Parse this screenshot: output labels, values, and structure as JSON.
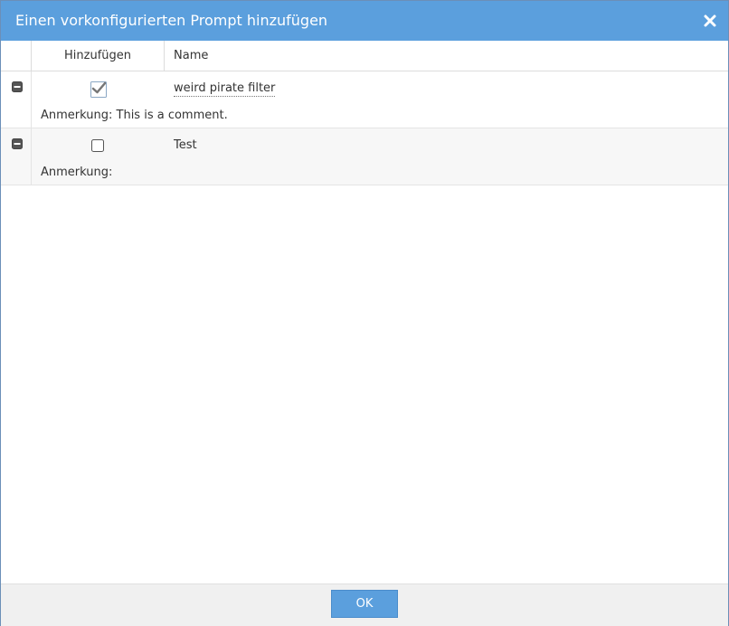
{
  "dialog": {
    "title": "Einen vorkonfigurierten Prompt hinzufügen",
    "close_icon": "close-icon"
  },
  "grid": {
    "columns": {
      "add": "Hinzufügen",
      "name": "Name"
    },
    "rows": [
      {
        "added": true,
        "name": "weird pirate filter",
        "note": "Anmerkung: This is a comment."
      },
      {
        "added": false,
        "name": "Test",
        "note": "Anmerkung:"
      }
    ]
  },
  "footer": {
    "ok_label": "OK"
  },
  "colors": {
    "accent": "#5b9fdd",
    "row_alt": "#f7f7f7",
    "footer_bg": "#f0f0f0"
  }
}
